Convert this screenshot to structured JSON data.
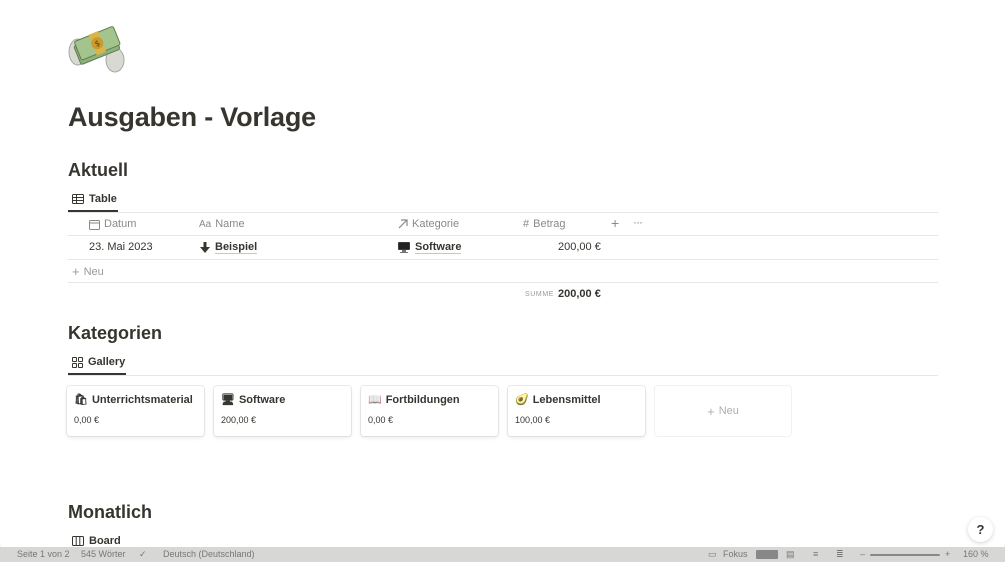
{
  "page": {
    "title": "Ausgaben - Vorlage",
    "icon": "money-with-wings-icon"
  },
  "sections": {
    "aktuell": {
      "heading": "Aktuell",
      "view_tab": "Table",
      "columns": {
        "datum": "Datum",
        "name": "Name",
        "kategorie": "Kategorie",
        "betrag": "Betrag"
      },
      "rows": [
        {
          "datum": "23. Mai 2023",
          "name": "Beispiel",
          "name_icon": "arrow-down-icon",
          "kategorie": "Software",
          "kategorie_icon": "computer-icon",
          "betrag": "200,00 €"
        }
      ],
      "add_row": "Neu",
      "sum_label": "SUMME",
      "sum_value": "200,00 €"
    },
    "kategorien": {
      "heading": "Kategorien",
      "view_tab": "Gallery",
      "cards": [
        {
          "title": "Unterrichtsmaterial",
          "emoji": "🛍",
          "value": "0,00 €"
        },
        {
          "title": "Software",
          "emoji": "🖥",
          "value": "200,00 €"
        },
        {
          "title": "Fortbildungen",
          "emoji": "📖",
          "value": "0,00 €"
        },
        {
          "title": "Lebensmittel",
          "emoji": "🥑",
          "value": "100,00 €"
        }
      ],
      "add_card": "Neu"
    },
    "monatlich": {
      "heading": "Monatlich",
      "view_tab": "Board"
    }
  },
  "help_label": "?",
  "statusbar": {
    "page_count": "Seite 1 von 2",
    "word_count": "545 Wörter",
    "language": "Deutsch (Deutschland)",
    "focus": "Fokus",
    "zoom": "160 %"
  }
}
